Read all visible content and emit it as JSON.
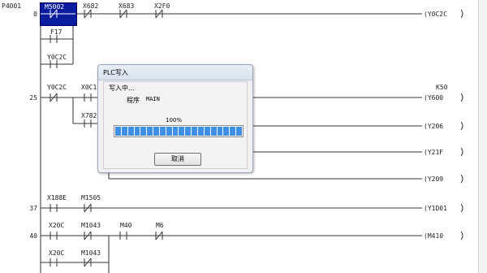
{
  "program": {
    "label": "P4001"
  },
  "steps": [
    "0",
    "25",
    "37",
    "40"
  ],
  "rung0": {
    "contacts": [
      "M5002",
      "X682",
      "X683",
      "X2F0",
      "F17",
      "Y0C2C"
    ],
    "coil": "(Y0C2C"
  },
  "rung25": {
    "contacts": [
      "Y0C2C",
      "X0C1",
      "X782"
    ],
    "coils": [
      "(Y600",
      "(Y206",
      "(Y21F",
      "(Y209"
    ],
    "coil_top_label": "K50"
  },
  "rung37": {
    "contacts": [
      "X188E",
      "M1505"
    ],
    "coil": "(Y1D01"
  },
  "rung40": {
    "contacts": [
      "X20C",
      "M1043",
      "M40",
      "M6",
      "X20C",
      "M1043"
    ],
    "coil": "(M410"
  },
  "dialog": {
    "title": "PLC写入",
    "status": "写入中...",
    "program_label": "程序",
    "program_name": "MAIN",
    "progress_text": "100%",
    "progress": 1.0,
    "cancel_label": "取消"
  }
}
